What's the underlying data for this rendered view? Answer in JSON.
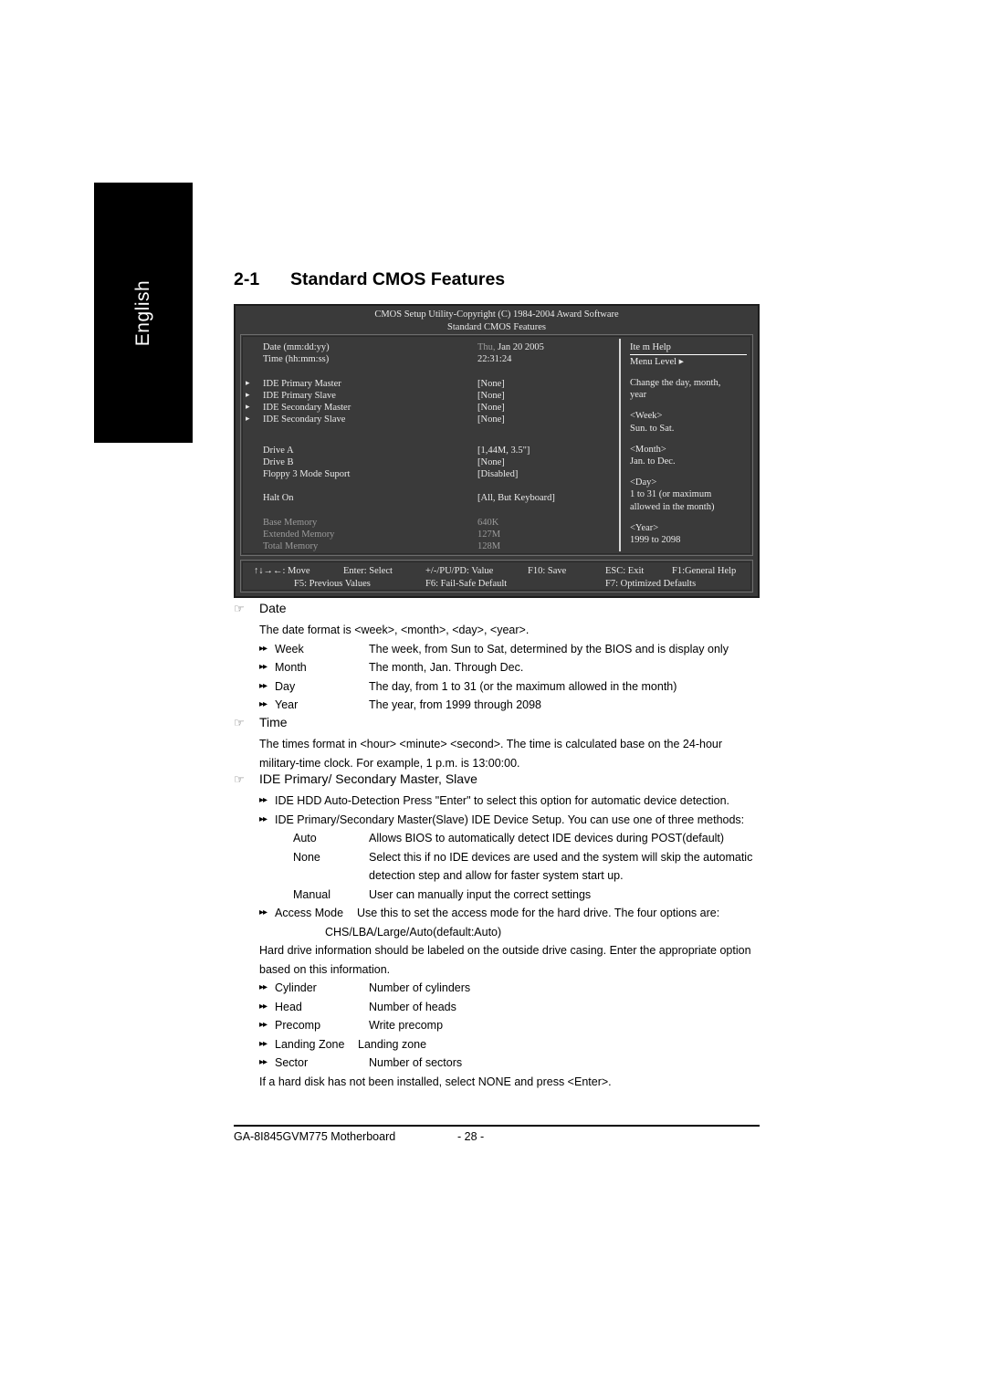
{
  "sidebar": {
    "language_label": "English"
  },
  "page": {
    "section_number": "2-1",
    "section_title": "Standard CMOS Features"
  },
  "bios": {
    "title_line1": "CMOS Setup Utility-Copyright (C) 1984-2004 Award Software",
    "title_line2": "Standard CMOS Features",
    "date_label": "Date  (mm:dd:yy)",
    "date_weekday": "Thu,",
    "date_value": "Jan 20 2005",
    "time_label": "Time (hh:mm:ss)",
    "time_value": "22:31:24",
    "ide_rows": [
      {
        "arrow": "▸",
        "label": "IDE Primary Master",
        "value": "[None]"
      },
      {
        "arrow": "▸",
        "label": "IDE Primary Slave",
        "value": "[None]"
      },
      {
        "arrow": "▸",
        "label": "IDE Secondary Master",
        "value": "[None]"
      },
      {
        "arrow": "▸",
        "label": "IDE Secondary Slave",
        "value": "[None]"
      }
    ],
    "drive_rows": [
      {
        "label": "Drive A",
        "value": "[1,44M, 3.5\"]"
      },
      {
        "label": "Drive B",
        "value": "[None]"
      },
      {
        "label": "Floppy 3 Mode Suport",
        "value": "[Disabled]"
      }
    ],
    "halt_label": "Halt On",
    "halt_value": "[All, But Keyboard]",
    "memory_rows": [
      {
        "label": "Base Memory",
        "value": "640K"
      },
      {
        "label": "Extended Memory",
        "value": "127M"
      },
      {
        "label": "Total Memory",
        "value": "128M"
      }
    ],
    "help": {
      "title": "Ite m Help",
      "menu_level": "Menu Level ▸",
      "desc_line1": "Change the day, month,",
      "desc_line2": "year",
      "week_head": "<Week>",
      "week_text": "Sun. to Sat.",
      "month_head": "<Month>",
      "month_text": "Jan. to Dec.",
      "day_head": "<Day>",
      "day_text1": "1 to 31 (or maximum",
      "day_text2": "allowed in the month)",
      "year_head": "<Year>",
      "year_text": "1999 to 2098"
    },
    "legend": {
      "move": "↑↓→←: Move",
      "enter": "Enter: Select",
      "value": "+/-/PU/PD: Value",
      "f10": "F10: Save",
      "esc": "ESC: Exit",
      "f1": "F1:General Help",
      "f5": "F5: Previous Values",
      "f6": "F6: Fail-Safe Default",
      "f7": "F7: Optimized Defaults"
    }
  },
  "sections": {
    "date": {
      "hand": "☞",
      "heading": "Date",
      "intro": "The date format is <week>, <month>, <day>, <year>.",
      "items": [
        {
          "bullet": "▸▸",
          "term": "Week",
          "desc": "The week, from Sun to Sat, determined by the BIOS and is display only"
        },
        {
          "bullet": "▸▸",
          "term": "Month",
          "desc": "The month, Jan. Through Dec."
        },
        {
          "bullet": "▸▸",
          "term": "Day",
          "desc": "The day, from 1 to 31 (or the maximum allowed in the month)"
        },
        {
          "bullet": "▸▸",
          "term": "Year",
          "desc": "The year, from 1999 through 2098"
        }
      ]
    },
    "time": {
      "hand": "☞",
      "heading": "Time",
      "line1": "The times format in <hour> <minute> <second>. The time is calculated base on the 24-hour",
      "line2": "military-time clock. For example, 1 p.m. is 13:00:00."
    },
    "ide": {
      "hand": "☞",
      "heading": "IDE Primary/ Secondary Master, Slave",
      "bullet1": "▸▸",
      "bullet1_text": "IDE HDD Auto-Detection Press \"Enter\" to select this option for automatic device detection.",
      "bullet2": "▸▸",
      "bullet2_text": "IDE Primary/Secondary Master(Slave) IDE Device Setup.  You can use one of three methods:",
      "methods": [
        {
          "term": "Auto",
          "desc": "Allows BIOS to automatically detect IDE devices during POST(default)"
        },
        {
          "term": "None",
          "desc": "Select this if no IDE devices are used and the system will skip the automatic"
        },
        {
          "term": "",
          "desc": "detection step and allow for faster system start up."
        },
        {
          "term": "Manual",
          "desc": "User can manually input the correct settings"
        }
      ],
      "access_bullet": "▸▸",
      "access_term": "Access Mode",
      "access_desc": "Use this to set the access mode for the hard drive. The four options are:",
      "access_desc2": "CHS/LBA/Large/Auto(default:Auto)",
      "hd_line1": "Hard drive information should be labeled on the outside drive casing.  Enter the appropriate option",
      "hd_line2": "based on this information.",
      "hd_items": [
        {
          "bullet": "▸▸",
          "term": "Cylinder",
          "desc": "Number of cylinders"
        },
        {
          "bullet": "▸▸",
          "term": "Head",
          "desc": "Number of heads"
        },
        {
          "bullet": "▸▸",
          "term": "Precomp",
          "desc": "Write precomp"
        },
        {
          "bullet": "▸▸",
          "term": "Landing Zone",
          "desc": "Landing zone"
        },
        {
          "bullet": "▸▸",
          "term": "Sector",
          "desc": "Number of sectors"
        }
      ],
      "closing": "If a hard disk has not been installed, select NONE and press <Enter>."
    }
  },
  "footer": {
    "model": "GA-8I845GVM775 Motherboard",
    "page_number": "- 28 -"
  }
}
